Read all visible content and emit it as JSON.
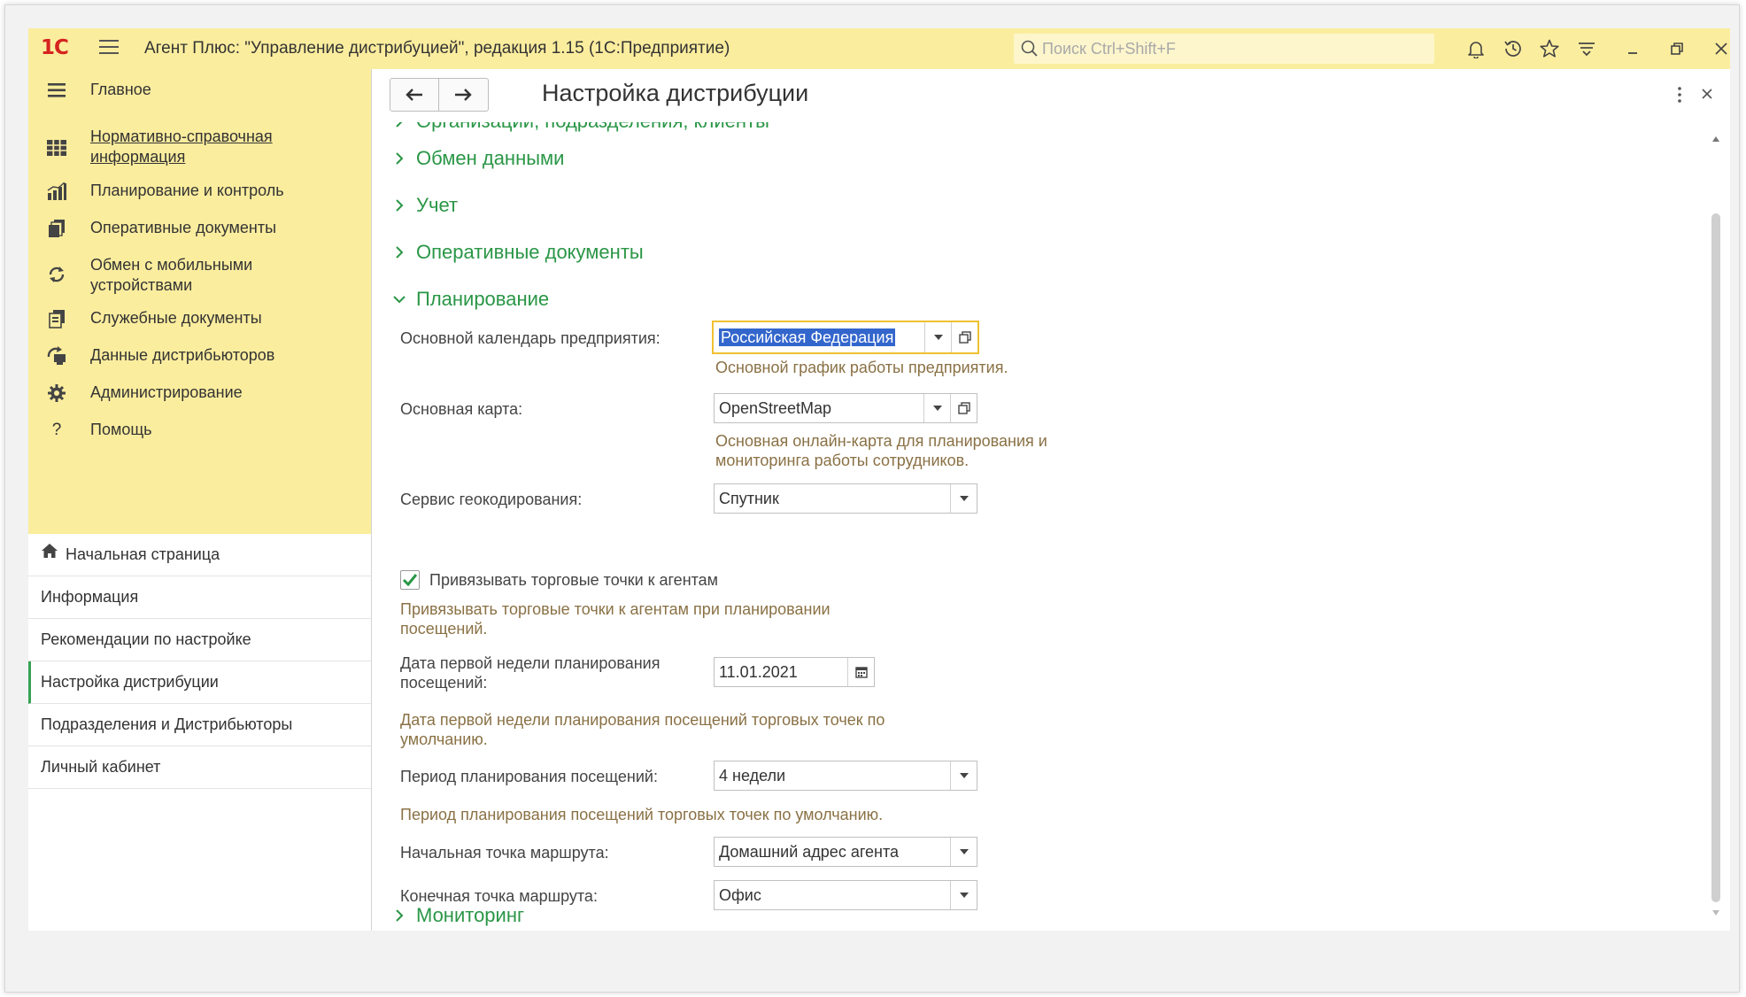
{
  "app": {
    "logo": "1С",
    "title": "Агент Плюс: \"Управление дистрибуцией\", редакция 1.15  (1С:Предприятие)",
    "search_placeholder": "Поиск Ctrl+Shift+F"
  },
  "titlebar_icons": [
    "bell-icon",
    "history-icon",
    "star-icon",
    "filter-icon",
    "minimize-icon",
    "restore-icon",
    "close-icon"
  ],
  "sidebar": {
    "sections": [
      {
        "label": "Главное",
        "icon": "menu-icon"
      },
      {
        "label": "Нормативно-справочная информация",
        "icon": "catalog-icon",
        "link": true
      },
      {
        "label": "Планирование и контроль",
        "icon": "chart-icon"
      },
      {
        "label": "Оперативные документы",
        "icon": "documents-icon"
      },
      {
        "label": "Обмен с мобильными устройствами",
        "icon": "sync-icon"
      },
      {
        "label": "Служебные документы",
        "icon": "service-documents-icon"
      },
      {
        "label": "Данные дистрибьюторов",
        "icon": "distributors-icon"
      },
      {
        "label": "Администрирование",
        "icon": "gear-icon"
      },
      {
        "label": "Помощь",
        "icon": "help-icon"
      }
    ],
    "open_windows": [
      {
        "label": "Начальная страница",
        "icon": "home-icon"
      },
      {
        "label": "Информация"
      },
      {
        "label": "Рекомендации по настройке"
      },
      {
        "label": "Настройка дистрибуции",
        "active": true
      },
      {
        "label": "Подразделения и Дистрибьюторы"
      },
      {
        "label": "Личный кабинет"
      }
    ]
  },
  "form": {
    "title": "Настройка дистрибуции",
    "groups": {
      "organizations": "Организации, подразделения, клиенты",
      "exchange": "Обмен данными",
      "accounting": "Учет",
      "operational": "Оперативные документы",
      "planning": "Планирование",
      "monitoring": "Мониторинг"
    },
    "planning": {
      "calendar_label": "Основной календарь предприятия:",
      "calendar_value": "Российская Федерация",
      "calendar_hint": "Основной график работы предприятия.",
      "map_label": "Основная карта:",
      "map_value": "OpenStreetMap",
      "map_hint_1": "Основная онлайн-карта для планирования и",
      "map_hint_2": "мониторинга работы сотрудников.",
      "geocoding_label": "Сервис геокодирования:",
      "geocoding_value": "Спутник",
      "bind_checkbox_label": "Привязывать торговые точки к агентам",
      "bind_checkbox_checked": true,
      "bind_hint_1": "Привязывать торговые точки к агентам при планировании",
      "bind_hint_2": "посещений.",
      "first_week_label_1": "Дата первой недели планирования",
      "first_week_label_2": "посещений:",
      "first_week_value": "11.01.2021",
      "first_week_hint_1": "Дата первой недели планирования посещений торговых точек по",
      "first_week_hint_2": "умолчанию.",
      "period_label": "Период планирования посещений:",
      "period_value": "4 недели",
      "period_hint": "Период планирования посещений торговых точек по умолчанию.",
      "start_point_label": "Начальная точка маршрута:",
      "start_point_value": "Домашний адрес агента",
      "end_point_label": "Конечная точка маршрута:",
      "end_point_value": "Офис"
    }
  },
  "colors": {
    "accent_yellow": "#fbed9e",
    "group_green": "#2a9646",
    "hint_brown": "#8a7145",
    "focus_border": "#f0c030",
    "logo_red": "#d5231f"
  }
}
